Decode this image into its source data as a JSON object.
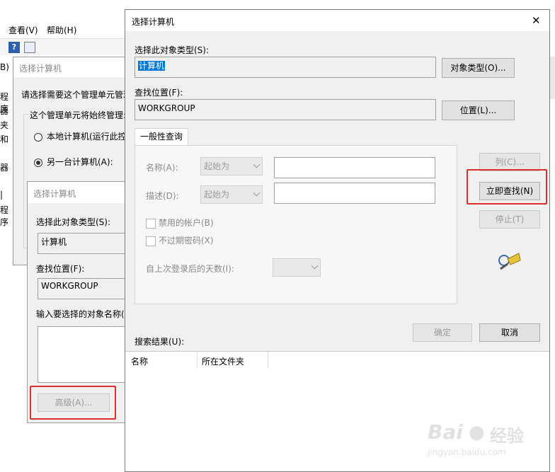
{
  "bg_window": {
    "menu": [
      "查看(V)",
      "帮助(H)"
    ],
    "left_fragments": [
      "B)",
      "程序",
      "器",
      "夹",
      "和",
      "器",
      "|",
      "程序"
    ]
  },
  "mid_dialog": {
    "title": "选择计算机",
    "instruction": "请选择需要这个管理单元管理",
    "group_label": "这个管理单元将始终管理:",
    "radio_local": "本地计算机(运行此控",
    "radio_other": "另一台计算机(A):"
  },
  "small_dialog": {
    "title": "选择计算机",
    "type_label": "选择此对象类型(S):",
    "type_value": "计算机",
    "location_label": "查找位置(F):",
    "location_value": "WORKGROUP",
    "name_label": "输入要选择的对象名称(",
    "advanced_button": "高级(A)..."
  },
  "main_dialog": {
    "title": "选择计算机",
    "close_glyph": "✕",
    "type_label": "选择此对象类型(S):",
    "type_value": "计算机",
    "object_types_button": "对象类型(O)...",
    "location_label": "查找位置(F):",
    "location_value": "WORKGROUP",
    "location_button": "位置(L)...",
    "tab_label": "一般性查询",
    "name_label": "名称(A):",
    "desc_label": "描述(D):",
    "starts_with_1": "起始为",
    "starts_with_2": "起始为",
    "disabled_accounts": "禁用的帐户(B)",
    "non_expiring": "不过期密码(X)",
    "days_label": "自上次登录后的天数(I):",
    "columns_button": "列(C)...",
    "find_now_button": "立即查找(N)",
    "stop_button": "停止(T)",
    "ok_button": "确定",
    "cancel_button": "取消",
    "results_label": "搜索结果(U):",
    "col_name": "名称",
    "col_folder": "所在文件夹"
  },
  "watermark": {
    "brand": "Bai",
    "brand2": "经验",
    "url": "jingyan.baidu.com"
  },
  "colors": {
    "highlight": "#0078d7",
    "red_box": "#e0302b"
  }
}
